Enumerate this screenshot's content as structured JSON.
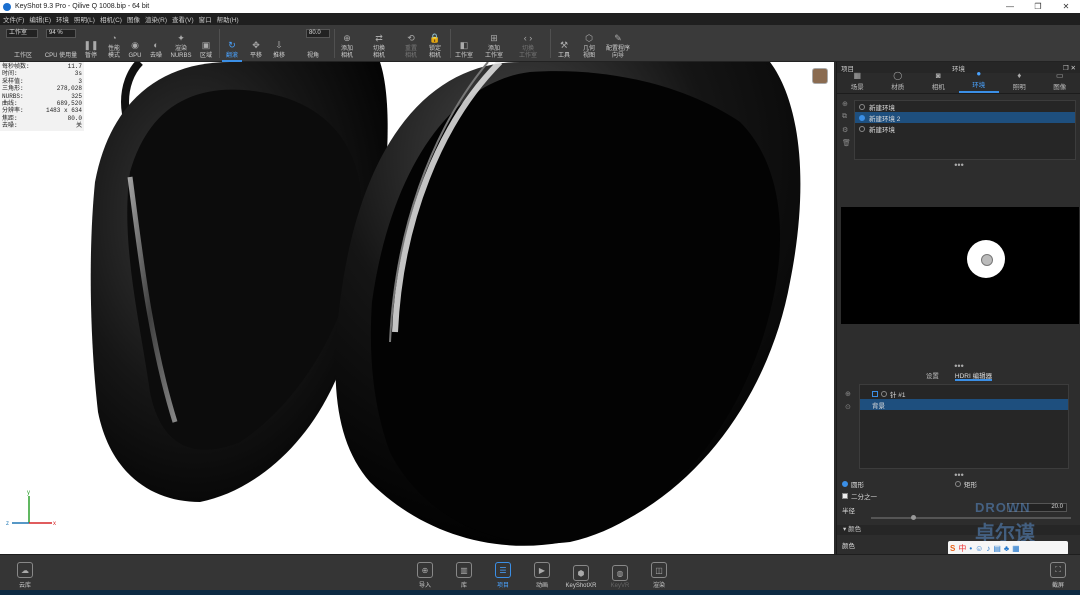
{
  "window": {
    "title": "KeyShot 9.3 Pro  - Qilive Q 1008.bip  - 64 bit"
  },
  "menu": [
    "文件(F)",
    "编辑(E)",
    "环境",
    "照明(L)",
    "相机(C)",
    "图像",
    "渲染(R)",
    "查看(V)",
    "窗口",
    "帮助(H)"
  ],
  "toolbar": {
    "workspace_value": "工作室",
    "cpu_value": "94 %",
    "fov_value": "80.0",
    "items": [
      "工作区",
      "CPU 使用量",
      "暂停",
      "性能\n模式",
      "GPU",
      "去噪",
      "渲染\nNURBS",
      "区域",
      "翻滚",
      "平移",
      "推移",
      "视角",
      "添加\n相机",
      "切换\n相机",
      "重置\n相机",
      "锁定\n相机",
      "工作室",
      "添加\n工作室",
      "切换\n工作室",
      "工具",
      "几何\n视图",
      "配置程序\n向导"
    ]
  },
  "stats": [
    {
      "k": "每秒帧数:",
      "v": "11.7"
    },
    {
      "k": "时间:",
      "v": "3s"
    },
    {
      "k": "采样值:",
      "v": "3"
    },
    {
      "k": "三角形:",
      "v": "278,028"
    },
    {
      "k": "NURBS:",
      "v": "325"
    },
    {
      "k": "曲线:",
      "v": "689,520"
    },
    {
      "k": "分辨率:",
      "v": "1483 x 634"
    },
    {
      "k": "焦距:",
      "v": "80.0"
    },
    {
      "k": "去噪:",
      "v": "关"
    }
  ],
  "axes": {
    "y": "y",
    "x": "x",
    "z": "z"
  },
  "panel": {
    "title_left": "项目",
    "title_center": "环境",
    "tabs": [
      "场景",
      "材质",
      "相机",
      "环境",
      "照明",
      "图像"
    ],
    "environments": [
      "新建环境",
      "新建环境 2",
      "新建环境"
    ],
    "subtabs": [
      "设置",
      "HDRI 编辑器"
    ],
    "hdri_items": [
      "针 #1",
      "背景"
    ],
    "shape_round": "圆形",
    "shape_rect": "矩形",
    "half": "二分之一",
    "radius_label": "半径",
    "radius_value": "20.0",
    "color_section": "颜色",
    "color_label": "颜色"
  },
  "bottom": [
    "云库",
    "导入",
    "库",
    "项目",
    "动画",
    "KeyShotXR",
    "KeyVR",
    "渲染",
    "截屏"
  ],
  "watermark": {
    "line1": "DROWN",
    "line2": "卓尔谟"
  }
}
